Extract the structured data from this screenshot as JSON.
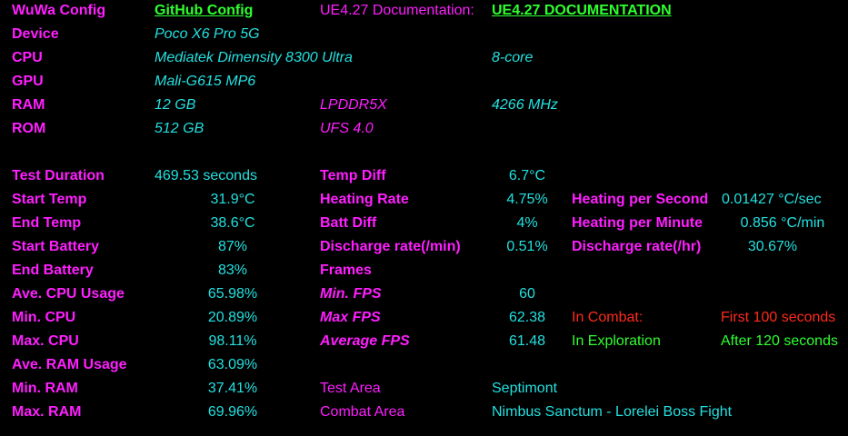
{
  "header": {
    "title": "WuWa Config",
    "github_link": "GitHub Config",
    "docs_label": "UE4.27 Documentation:",
    "docs_link": "UE4.27 DOCUMENTATION"
  },
  "specs": {
    "device": {
      "label": "Device",
      "value": "Poco X6 Pro 5G"
    },
    "cpu": {
      "label": "CPU",
      "value": "Mediatek Dimensity 8300 Ultra",
      "extra": "8-core"
    },
    "gpu": {
      "label": "GPU",
      "value": "Mali-G615 MP6"
    },
    "ram": {
      "label": "RAM",
      "value": "12 GB",
      "type": "LPDDR5X",
      "speed": "4266 MHz"
    },
    "rom": {
      "label": "ROM",
      "value": "512 GB",
      "type": "UFS 4.0"
    }
  },
  "stats": {
    "test_duration": {
      "label": "Test Duration",
      "value": "469.53 seconds"
    },
    "start_temp": {
      "label": "Start Temp",
      "value": "31.9°C"
    },
    "end_temp": {
      "label": "End Temp",
      "value": "38.6°C"
    },
    "start_battery": {
      "label": "Start Battery",
      "value": "87%"
    },
    "end_battery": {
      "label": "End Battery",
      "value": "83%"
    },
    "ave_cpu": {
      "label": "Ave. CPU Usage",
      "value": "65.98%"
    },
    "min_cpu": {
      "label": "Min. CPU",
      "value": "20.89%"
    },
    "max_cpu": {
      "label": "Max. CPU",
      "value": "98.11%"
    },
    "ave_ram": {
      "label": "Ave. RAM Usage",
      "value": "63.09%"
    },
    "min_ram": {
      "label": "Min. RAM",
      "value": "37.41%"
    },
    "max_ram": {
      "label": "Max. RAM",
      "value": "69.96%"
    }
  },
  "thermal": {
    "temp_diff": {
      "label": "Temp Diff",
      "value": "6.7°C"
    },
    "heating_rate": {
      "label": "Heating Rate",
      "value": "4.75%"
    },
    "batt_diff": {
      "label": "Batt Diff",
      "value": "4%"
    },
    "discharge_min": {
      "label": "Discharge rate(/min)",
      "value": "0.51%"
    },
    "frames": {
      "label": "Frames"
    },
    "min_fps": {
      "label": "Min. FPS",
      "value": "60"
    },
    "max_fps": {
      "label": "Max FPS",
      "value": "62.38"
    },
    "avg_fps": {
      "label": "Average FPS",
      "value": "61.48"
    },
    "test_area": {
      "label": "Test Area",
      "value": "Septimont"
    },
    "combat_area": {
      "label": "Combat Area",
      "value": "Nimbus Sanctum - Lorelei Boss Fight"
    }
  },
  "rates": {
    "heat_sec": {
      "label": "Heating per Second",
      "value": "0.01427 °C/sec"
    },
    "heat_min": {
      "label": "Heating per Minute",
      "value": "0.856 °C/min"
    },
    "discharge_hr": {
      "label": "Discharge rate(/hr)",
      "value": "30.67%"
    }
  },
  "legend": {
    "combat": {
      "label": "In Combat:",
      "value": "First 100 seconds"
    },
    "exploration": {
      "label": "In Exploration",
      "value": "After 120 seconds"
    }
  },
  "colors": {
    "background": "#000000",
    "label": "#ff1fff",
    "value": "#23e0e0",
    "link": "#2fff2f",
    "combat": "#ff2a1a",
    "exploration": "#2fff2f"
  }
}
